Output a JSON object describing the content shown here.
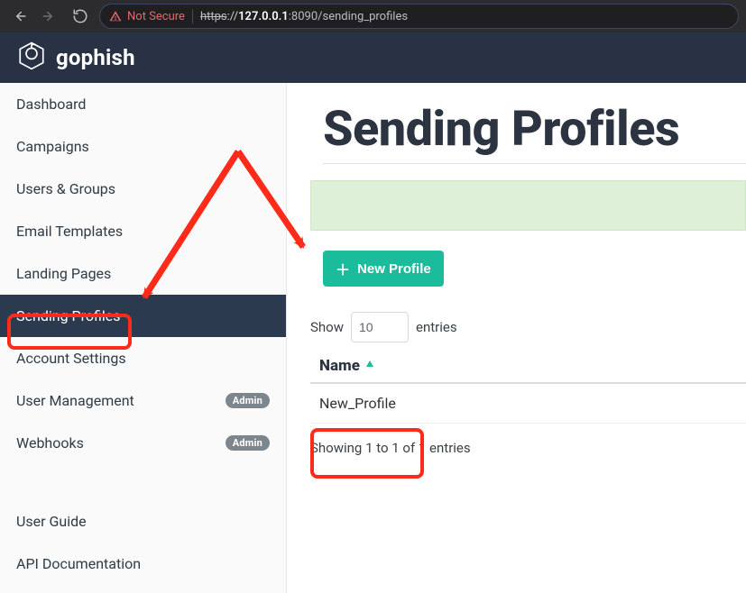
{
  "browser": {
    "not_secure": "Not Secure",
    "url_parts": {
      "scheme_strike": "https",
      "sep": "://",
      "host": "127.0.0.1",
      "port": ":8090",
      "path": "/sending_profiles"
    }
  },
  "brand": {
    "name": "gophish"
  },
  "sidebar": {
    "items": [
      {
        "label": "Dashboard"
      },
      {
        "label": "Campaigns"
      },
      {
        "label": "Users & Groups"
      },
      {
        "label": "Email Templates"
      },
      {
        "label": "Landing Pages"
      },
      {
        "label": "Sending Profiles"
      },
      {
        "label": "Account Settings"
      },
      {
        "label": "User Management",
        "badge": "Admin"
      },
      {
        "label": "Webhooks",
        "badge": "Admin"
      },
      {
        "label": "User Guide"
      },
      {
        "label": "API Documentation"
      }
    ]
  },
  "main": {
    "title": "Sending Profiles",
    "new_profile": "New Profile",
    "show_label": "Show",
    "entries_value": "10",
    "entries_label": "entries",
    "columns": {
      "name": "Name"
    },
    "rows": [
      {
        "name": "New_Profile"
      }
    ],
    "info": "Showing 1 to 1 of 1 entries"
  }
}
